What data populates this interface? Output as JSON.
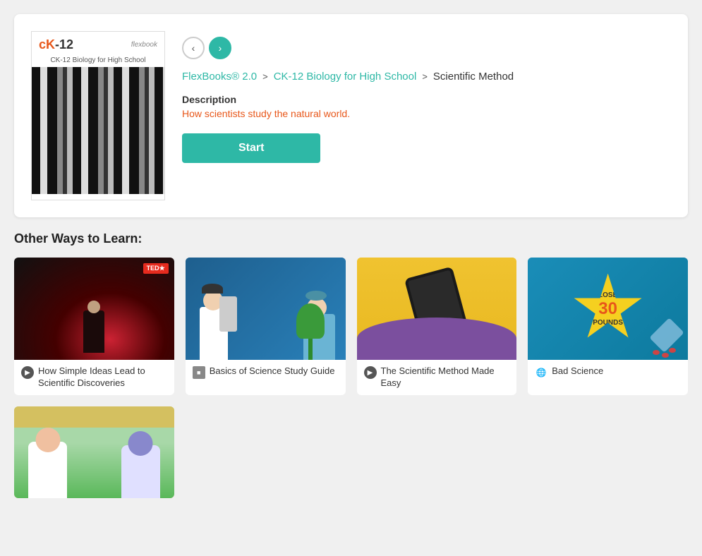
{
  "breadcrumb": {
    "link1": "FlexBooks® 2.0",
    "link2": "CK-12 Biology for High School",
    "current": "Scientific Method",
    "sep1": ">",
    "sep2": ">"
  },
  "book": {
    "title": "CK-12",
    "subtitle": "CK-12 Biology for High School",
    "publisher": "flexbook"
  },
  "description": {
    "label": "Description",
    "text": "How scientists study the natural world."
  },
  "buttons": {
    "start": "Start",
    "prev_arrow": "‹",
    "next_arrow": "›"
  },
  "other_ways": {
    "title": "Other Ways to Learn:",
    "resources": [
      {
        "title": "How Simple Ideas Lead to Scientific Discoveries",
        "type": "video",
        "type_icon": "▶"
      },
      {
        "title": "Basics of Science Study Guide",
        "type": "guide",
        "type_icon": "▪"
      },
      {
        "title": "The Scientific Method Made Easy",
        "type": "video",
        "type_icon": "▶"
      },
      {
        "title": "Bad Science",
        "type": "globe",
        "type_icon": "🌐"
      }
    ],
    "lose_label": "LOSE",
    "thirty_label": "30",
    "pounds_label": "POUNDS"
  }
}
